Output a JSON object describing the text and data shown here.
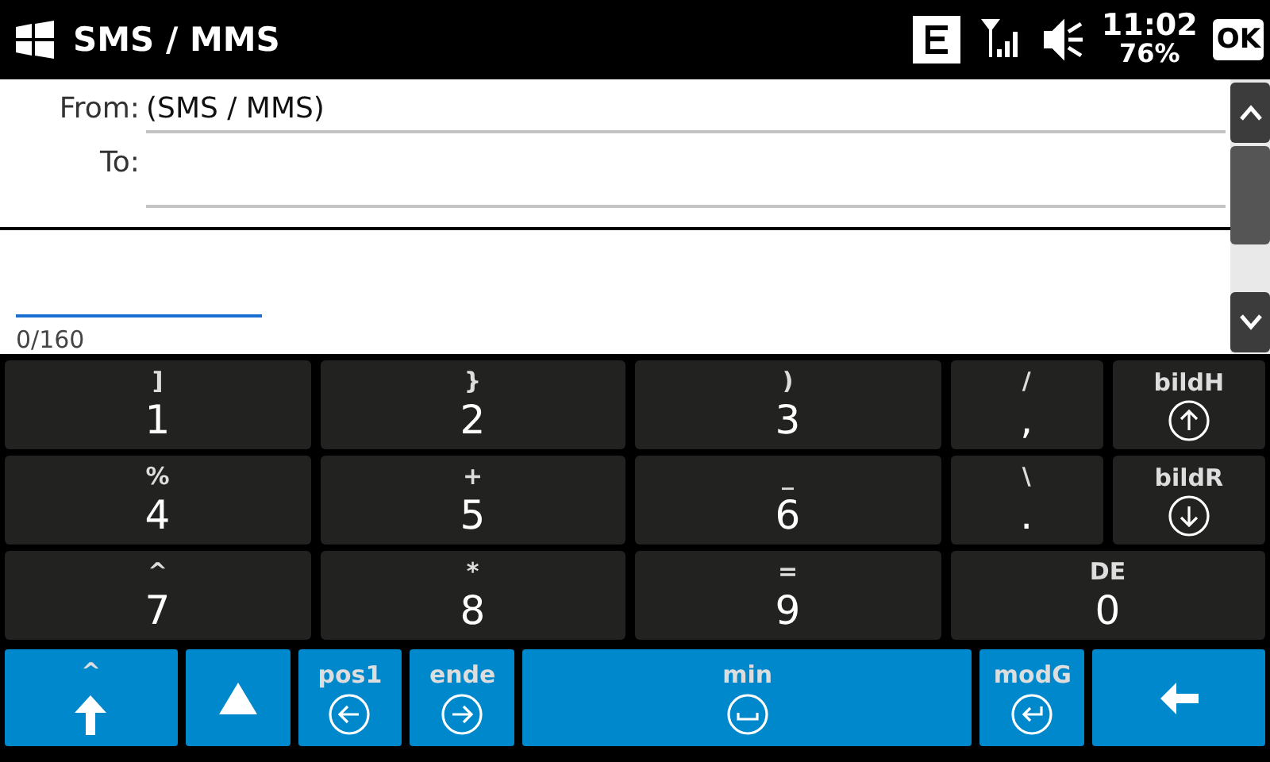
{
  "title_bar": {
    "title": "SMS / MMS",
    "time": "11:02",
    "battery": "76%",
    "ok": "OK"
  },
  "compose": {
    "from_label": "From:",
    "from_value": "(SMS / MMS)",
    "to_label": "To:",
    "counter": "0/160"
  },
  "keypad_rows": [
    [
      {
        "top": "]",
        "main": "1"
      },
      {
        "top": "}",
        "main": "2"
      },
      {
        "top": ")",
        "main": "3"
      },
      {
        "top": "/",
        "main": ","
      },
      {
        "top": "bildH",
        "kind": "up"
      }
    ],
    [
      {
        "top": "%",
        "main": "4"
      },
      {
        "top": "+",
        "main": "5"
      },
      {
        "top": "_",
        "main": "6"
      },
      {
        "top": "\\",
        "main": "."
      },
      {
        "top": "bildR",
        "kind": "down"
      }
    ],
    [
      {
        "top": "^",
        "main": "7"
      },
      {
        "top": "*",
        "main": "8"
      },
      {
        "top": "=",
        "main": "9"
      },
      {
        "top": "DE",
        "main": "0"
      }
    ]
  ],
  "bottom_keys": [
    {
      "top": "^",
      "kind": "shift"
    },
    {
      "kind": "triangle"
    },
    {
      "top": "pos1",
      "kind": "left"
    },
    {
      "top": "ende",
      "kind": "right"
    },
    {
      "top": "min",
      "kind": "space"
    },
    {
      "top": "modG",
      "kind": "enter"
    },
    {
      "kind": "backspace"
    }
  ]
}
